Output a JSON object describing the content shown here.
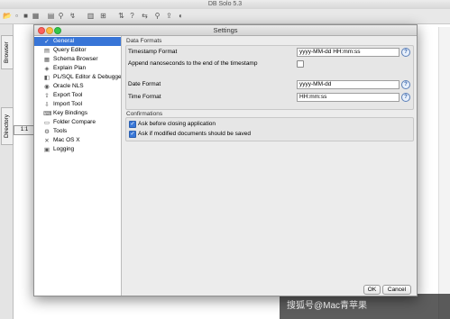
{
  "app": {
    "title": "DB Solo 5.3",
    "rail_tabs": [
      "Browser",
      "Directory"
    ],
    "strip_label": "1:1"
  },
  "watermark": "搜狐号@Mac青苹果",
  "dialog": {
    "title": "Settings",
    "nav_items": [
      {
        "label": "General",
        "icon": "check-icon",
        "glyph": "✓"
      },
      {
        "label": "Query Editor",
        "icon": "editor-icon",
        "glyph": "▤"
      },
      {
        "label": "Schema Browser",
        "icon": "schema-icon",
        "glyph": "▦"
      },
      {
        "label": "Explain Plan",
        "icon": "plan-icon",
        "glyph": "◈"
      },
      {
        "label": "PL/SQL Editor & Debugger",
        "icon": "plsql-icon",
        "glyph": "◧"
      },
      {
        "label": "Oracle NLS",
        "icon": "oracle-icon",
        "glyph": "◉"
      },
      {
        "label": "Export Tool",
        "icon": "export-icon",
        "glyph": "⇪"
      },
      {
        "label": "Import Tool",
        "icon": "import-icon",
        "glyph": "⇩"
      },
      {
        "label": "Key Bindings",
        "icon": "keyboard-icon",
        "glyph": "⌨"
      },
      {
        "label": "Folder Compare",
        "icon": "folder-icon",
        "glyph": "▭"
      },
      {
        "label": "Tools",
        "icon": "tools-icon",
        "glyph": "⚙"
      },
      {
        "label": "Mac OS X",
        "icon": "mac-icon",
        "glyph": "✕"
      },
      {
        "label": "Logging",
        "icon": "log-icon",
        "glyph": "▣"
      }
    ],
    "data_formats": {
      "title": "Data Formats",
      "timestamp_label": "Timestamp Format",
      "timestamp_value": "yyyy-MM-dd HH:mm:ss",
      "nanos_label": "Append nanoseconds to the end of the timestamp",
      "nanos_checked": false,
      "date_label": "Date Format",
      "date_value": "yyyy-MM-dd",
      "time_label": "Time Format",
      "time_value": "HH:mm:ss",
      "help": "?"
    },
    "confirmations": {
      "title": "Confirmations",
      "ask_close_label": "Ask before closing application",
      "ask_close_checked": true,
      "ask_save_label": "Ask if modified documents should be saved",
      "ask_save_checked": true
    },
    "buttons": {
      "ok": "OK",
      "cancel": "Cancel"
    }
  }
}
